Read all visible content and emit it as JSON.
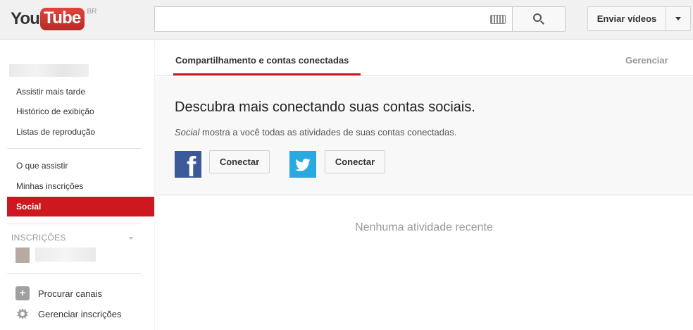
{
  "header": {
    "logo_you": "You",
    "logo_tube": "Tube",
    "logo_region": "BR",
    "search_value": "",
    "upload_label": "Enviar vídeos"
  },
  "sidebar": {
    "items_top": [
      {
        "label": "Assistir mais tarde"
      },
      {
        "label": "Histórico de exibição"
      },
      {
        "label": "Listas de reprodução"
      }
    ],
    "items_mid": [
      {
        "label": "O que assistir"
      },
      {
        "label": "Minhas inscrições"
      },
      {
        "label": "Social",
        "active": true
      }
    ],
    "subscriptions_title": "INSCRIÇÕES",
    "actions": [
      {
        "label": "Procurar canais",
        "icon": "plus-icon"
      },
      {
        "label": "Gerenciar inscrições",
        "icon": "gear-icon"
      }
    ]
  },
  "main": {
    "tab_label": "Compartilhamento e contas conectadas",
    "manage_label": "Gerenciar",
    "panel_title": "Descubra mais conectando suas contas sociais.",
    "panel_sub_em": "Social",
    "panel_sub_rest": " mostra a você todas as atividades de suas contas conectadas.",
    "facebook_button": "Conectar",
    "twitter_button": "Conectar",
    "empty_message": "Nenhuma atividade recente"
  },
  "colors": {
    "brand_red": "#cc181e",
    "facebook_blue": "#3b5998",
    "twitter_blue": "#2aa9e0"
  }
}
